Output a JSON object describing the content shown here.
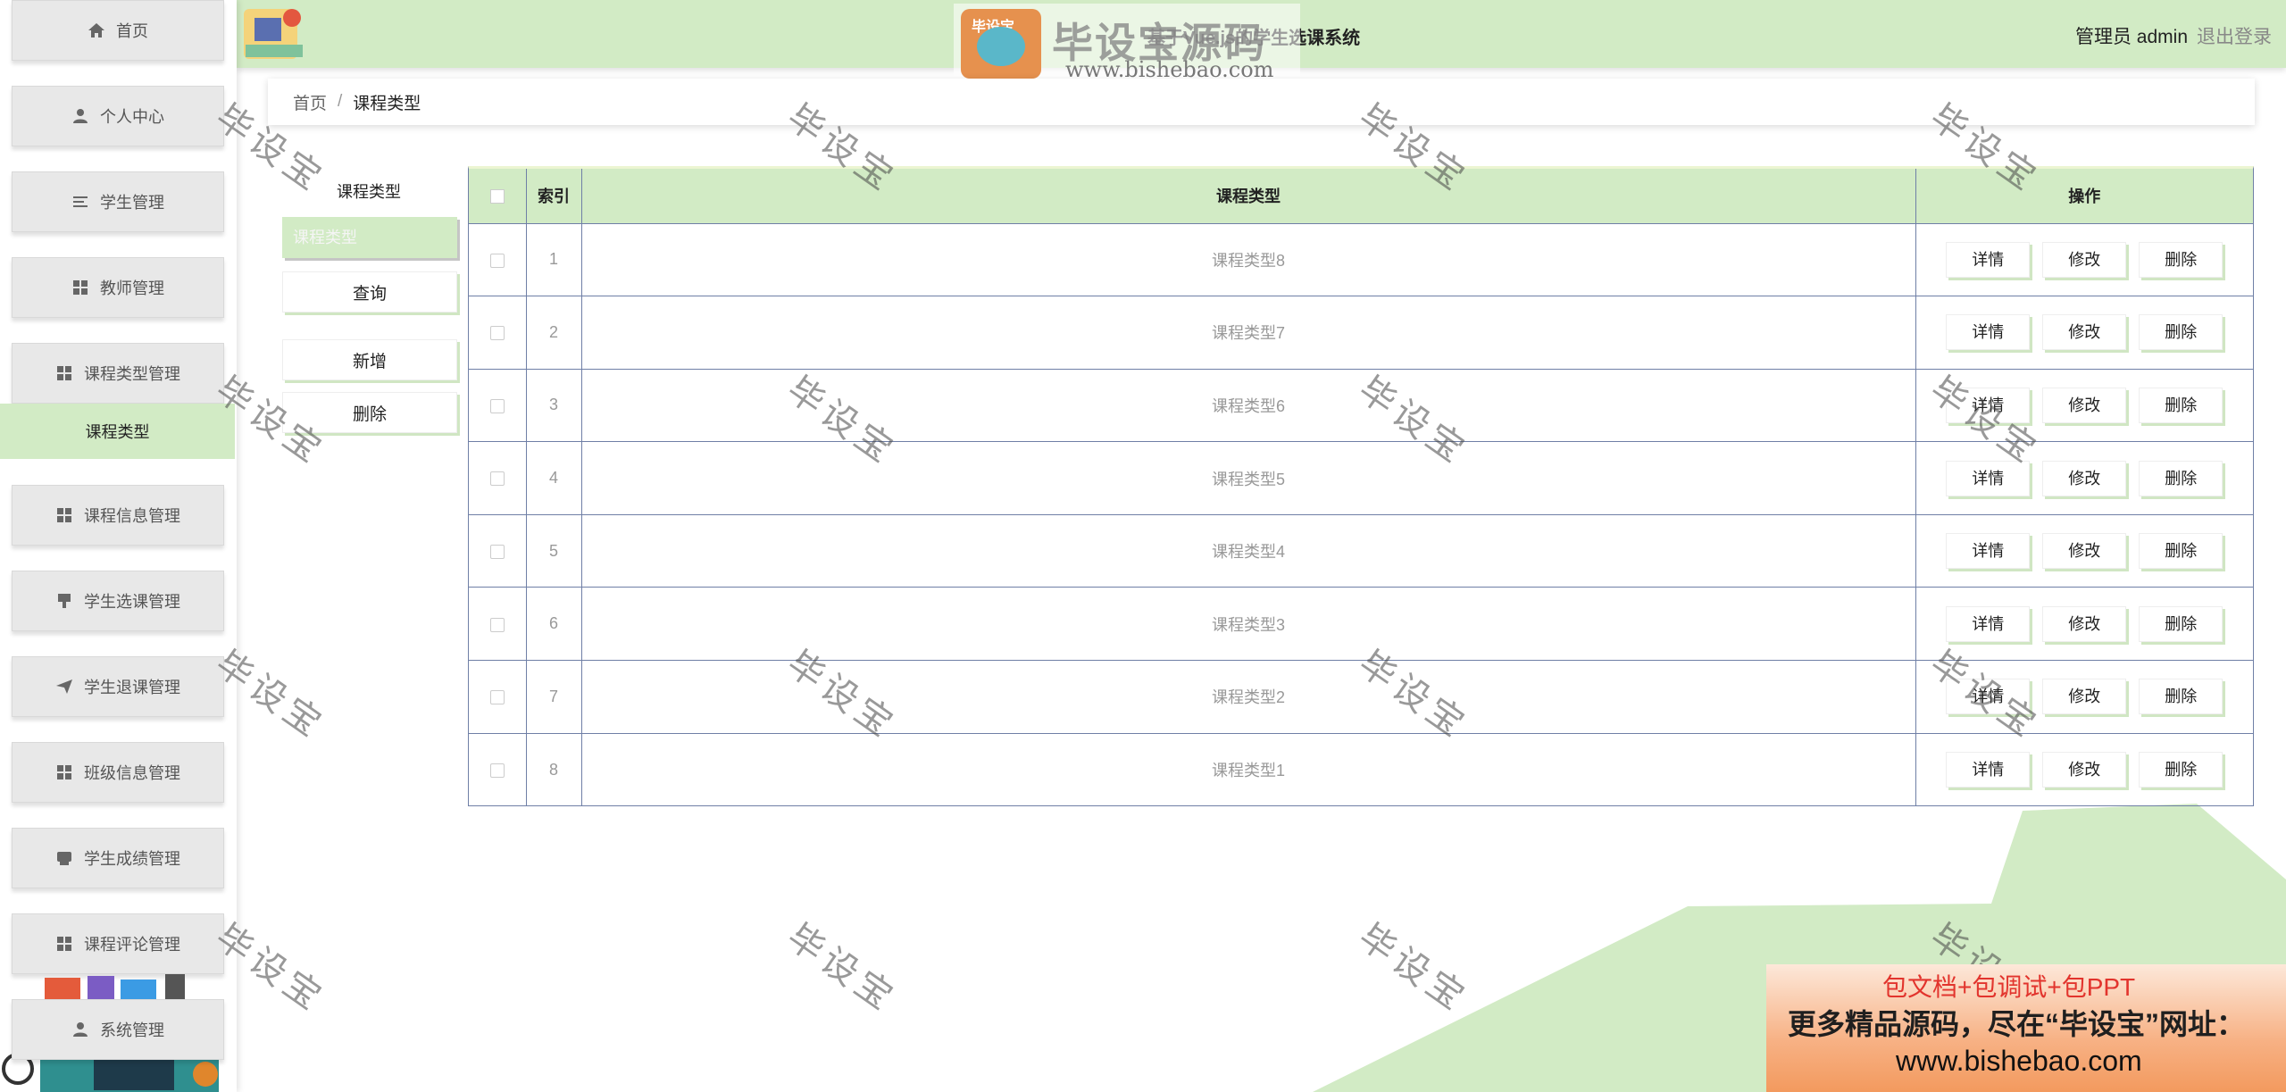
{
  "app": {
    "title": "基于Vue.js的学生选课系统",
    "user": "管理员 admin",
    "logout": "退出登录"
  },
  "sidebar": {
    "items": [
      {
        "label": "首页",
        "icon": "home-icon"
      },
      {
        "label": "个人中心",
        "icon": "user-icon"
      },
      {
        "label": "学生管理",
        "icon": "list-icon"
      },
      {
        "label": "教师管理",
        "icon": "grid-icon"
      },
      {
        "label": "课程类型管理",
        "icon": "grid-icon"
      },
      {
        "label": "课程信息管理",
        "icon": "grid-icon"
      },
      {
        "label": "学生选课管理",
        "icon": "pin-icon"
      },
      {
        "label": "学生退课管理",
        "icon": "send-icon"
      },
      {
        "label": "班级信息管理",
        "icon": "grid-icon"
      },
      {
        "label": "学生成绩管理",
        "icon": "printer-icon"
      },
      {
        "label": "课程评论管理",
        "icon": "grid-icon"
      },
      {
        "label": "系统管理",
        "icon": "user-icon"
      }
    ],
    "active_sub": "课程类型"
  },
  "breadcrumb": {
    "home": "首页",
    "separator": "/",
    "current": "课程类型"
  },
  "search": {
    "label": "课程类型",
    "placeholder": "课程类型",
    "query_button": "查询",
    "add_button": "新增",
    "delete_button": "删除"
  },
  "table": {
    "headers": {
      "index": "索引",
      "type": "课程类型",
      "ops": "操作"
    },
    "rows": [
      {
        "index": "1",
        "type": "课程类型8"
      },
      {
        "index": "2",
        "type": "课程类型7"
      },
      {
        "index": "3",
        "type": "课程类型6"
      },
      {
        "index": "4",
        "type": "课程类型5"
      },
      {
        "index": "5",
        "type": "课程类型4"
      },
      {
        "index": "6",
        "type": "课程类型3"
      },
      {
        "index": "7",
        "type": "课程类型2"
      },
      {
        "index": "8",
        "type": "课程类型1"
      }
    ],
    "ops": {
      "detail": "详情",
      "edit": "修改",
      "delete": "删除"
    }
  },
  "watermark": {
    "text": "毕设宝",
    "brand": "毕设宝源码网",
    "badge": "毕设宝",
    "url": "www.bishebao.com"
  },
  "promo": {
    "line1": "包文档+包调试+包PPT",
    "line2": "更多精品源码，尽在“毕设宝”网址：",
    "line3": "www.bishebao.com"
  },
  "colors": {
    "accent": "#d2ebc5",
    "border": "#6f7fa6"
  }
}
